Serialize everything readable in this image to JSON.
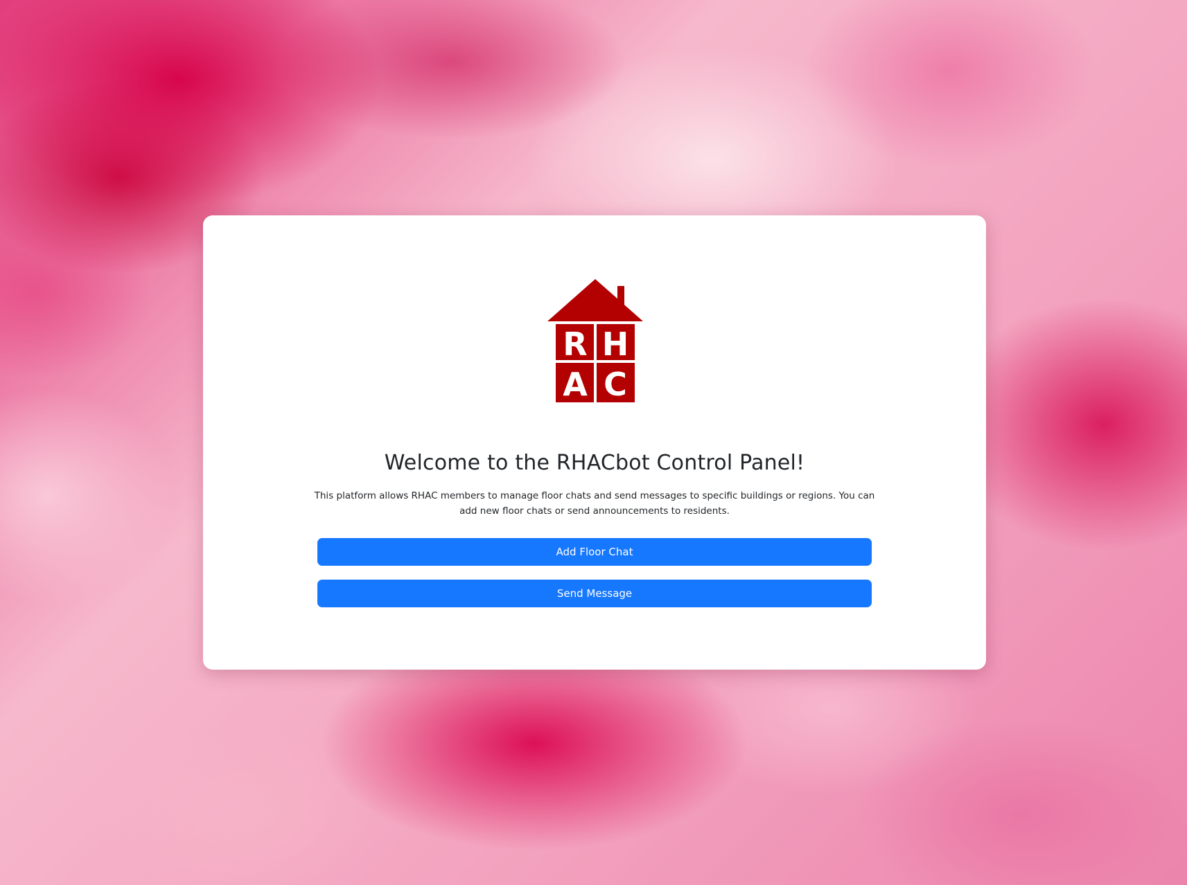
{
  "colors": {
    "accent": "#1677ff",
    "logo_red": "#b30000",
    "card_background": "#ffffff",
    "text": "#212529"
  },
  "logo": {
    "icon": "rhac-house-logo",
    "letters": [
      "R",
      "H",
      "A",
      "C"
    ]
  },
  "main": {
    "title": "Welcome to the RHACbot Control Panel!",
    "description": "This platform allows RHAC members to manage floor chats and send messages to specific buildings or regions. You can add new floor chats or send announcements to residents.",
    "add_floor_chat_label": "Add Floor Chat",
    "send_message_label": "Send Message"
  }
}
